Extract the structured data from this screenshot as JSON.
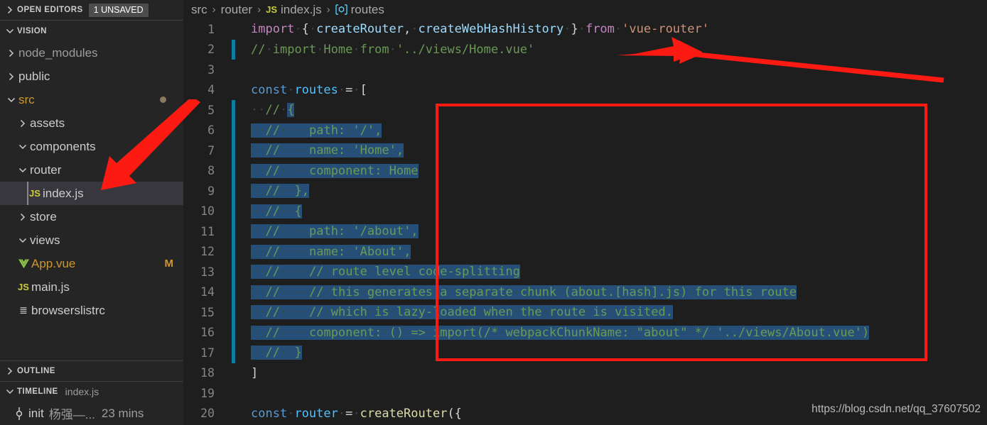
{
  "sidebar": {
    "open_editors": {
      "label": "OPEN EDITORS",
      "badge": "1 UNSAVED",
      "twisty": "chevron-right-icon"
    },
    "workspace": {
      "label": "VISION",
      "twisty": "chevron-down-icon"
    },
    "tree": [
      {
        "label": "node_modules",
        "icon": "chevron-right-icon",
        "depth": 1,
        "kind": "folder",
        "style": "dim"
      },
      {
        "label": "public",
        "icon": "chevron-right-icon",
        "depth": 1,
        "kind": "folder",
        "style": "normal"
      },
      {
        "label": "src",
        "icon": "chevron-down-icon",
        "depth": 1,
        "kind": "folder",
        "style": "orange",
        "dot": true
      },
      {
        "label": "assets",
        "icon": "chevron-right-icon",
        "depth": 2,
        "kind": "folder",
        "style": "normal"
      },
      {
        "label": "components",
        "icon": "chevron-down-icon",
        "depth": 2,
        "kind": "folder",
        "style": "normal"
      },
      {
        "label": "router",
        "icon": "chevron-down-icon",
        "depth": 2,
        "kind": "folder",
        "style": "normal"
      },
      {
        "label": "index.js",
        "icon": "js-file-icon",
        "depth": 3,
        "kind": "file",
        "style": "normal",
        "selected": true
      },
      {
        "label": "store",
        "icon": "chevron-right-icon",
        "depth": 2,
        "kind": "folder",
        "style": "normal"
      },
      {
        "label": "views",
        "icon": "chevron-down-icon",
        "depth": 2,
        "kind": "folder",
        "style": "normal"
      },
      {
        "label": "App.vue",
        "icon": "vue-file-icon",
        "depth": 2,
        "kind": "file",
        "style": "orange",
        "badge": "M"
      },
      {
        "label": "main.js",
        "icon": "js-file-icon",
        "depth": 2,
        "kind": "file",
        "style": "normal"
      },
      {
        "label": "browserslistrc",
        "icon": "config-file-icon",
        "depth": 2,
        "kind": "file",
        "style": "normal"
      }
    ],
    "outline": {
      "label": "OUTLINE",
      "twisty": "chevron-right-icon"
    },
    "timeline": {
      "label": "TIMELINE",
      "sub": "index.js",
      "twisty": "chevron-down-icon"
    },
    "timeline_items": [
      {
        "icon": "git-commit-icon",
        "label": "init",
        "author": "杨强—...",
        "time": "23 mins"
      }
    ]
  },
  "breadcrumb": {
    "items": [
      "src",
      "router",
      "index.js",
      "routes"
    ],
    "separator": "›",
    "file_icon": "JS",
    "symbol_icon": "symbol-variable-icon"
  },
  "colors": {
    "editor_bg": "#1e1e1e",
    "sidebar_bg": "#252526",
    "selection": "#264f78",
    "annotation_red": "#fd1a12",
    "gutter_modified": "#0c7d9d",
    "comment_green": "#6a9955"
  },
  "editor": {
    "lines": [
      {
        "n": "1",
        "modified": false,
        "tokens": [
          {
            "t": "import ",
            "c": "t-kw"
          },
          {
            "t": "{ ",
            "c": "t-plain"
          },
          {
            "t": "createRouter",
            "c": "t-id"
          },
          {
            "t": ", ",
            "c": "t-plain"
          },
          {
            "t": "createWebHashHistory",
            "c": "t-id"
          },
          {
            "t": " } ",
            "c": "t-plain"
          },
          {
            "t": "from",
            "c": "t-kw"
          },
          {
            "t": " ",
            "c": "t-plain"
          },
          {
            "t": "'vue-router'",
            "c": "t-str"
          }
        ]
      },
      {
        "n": "2",
        "modified": true,
        "tokens": [
          {
            "t": "// import Home from '../views/Home.vue'",
            "c": "t-com"
          }
        ]
      },
      {
        "n": "3",
        "modified": false,
        "tokens": []
      },
      {
        "n": "4",
        "modified": false,
        "tokens": [
          {
            "t": "const",
            "c": "t-kw2"
          },
          {
            "t": " ",
            "c": "t-plain"
          },
          {
            "t": "routes",
            "c": "t-var"
          },
          {
            "t": " = [",
            "c": "t-plain"
          }
        ]
      },
      {
        "n": "5",
        "modified": true,
        "tokens": [
          {
            "t": "  ",
            "c": "ws",
            "ws": true
          },
          {
            "t": "// ",
            "c": "t-com"
          },
          {
            "t": "{",
            "c": "t-com",
            "sel": true
          }
        ]
      },
      {
        "n": "6",
        "modified": true,
        "selected_all": true,
        "tokens": [
          {
            "t": "  //    path: '/',",
            "c": "t-com"
          }
        ]
      },
      {
        "n": "7",
        "modified": true,
        "selected_all": true,
        "tokens": [
          {
            "t": "  //    name: 'Home',",
            "c": "t-com"
          }
        ]
      },
      {
        "n": "8",
        "modified": true,
        "selected_all": true,
        "tokens": [
          {
            "t": "  //    component: Home",
            "c": "t-com"
          }
        ]
      },
      {
        "n": "9",
        "modified": true,
        "selected_all": true,
        "tokens": [
          {
            "t": "  //  },",
            "c": "t-com"
          }
        ]
      },
      {
        "n": "10",
        "modified": true,
        "selected_all": true,
        "tokens": [
          {
            "t": "  //  {",
            "c": "t-com"
          }
        ]
      },
      {
        "n": "11",
        "modified": true,
        "selected_all": true,
        "tokens": [
          {
            "t": "  //    path: '/about',",
            "c": "t-com"
          }
        ]
      },
      {
        "n": "12",
        "modified": true,
        "selected_all": true,
        "tokens": [
          {
            "t": "  //    name: 'About',",
            "c": "t-com"
          }
        ]
      },
      {
        "n": "13",
        "modified": true,
        "selected_all": true,
        "tokens": [
          {
            "t": "  //    // route level code-splitting",
            "c": "t-com"
          }
        ]
      },
      {
        "n": "14",
        "modified": true,
        "selected_all": true,
        "tokens": [
          {
            "t": "  //    // this generates a separate chunk (about.[hash].js) for this route",
            "c": "t-com"
          }
        ]
      },
      {
        "n": "15",
        "modified": true,
        "selected_all": true,
        "tokens": [
          {
            "t": "  //    // which is lazy-loaded when the route is visited.",
            "c": "t-com"
          }
        ]
      },
      {
        "n": "16",
        "modified": true,
        "selected_all": true,
        "tokens": [
          {
            "t": "  //    component: () => import(/* webpackChunkName: \"about\" */ '../views/About.vue')",
            "c": "t-com"
          }
        ]
      },
      {
        "n": "17",
        "modified": true,
        "selected_all": true,
        "tokens": [
          {
            "t": "  //  }",
            "c": "t-com"
          }
        ]
      },
      {
        "n": "18",
        "modified": false,
        "tokens": [
          {
            "t": "]",
            "c": "t-plain"
          }
        ]
      },
      {
        "n": "19",
        "modified": false,
        "tokens": []
      },
      {
        "n": "20",
        "modified": false,
        "tokens": [
          {
            "t": "const",
            "c": "t-kw2"
          },
          {
            "t": " ",
            "c": "t-plain"
          },
          {
            "t": "router",
            "c": "t-var"
          },
          {
            "t": " = ",
            "c": "t-plain"
          },
          {
            "t": "createRouter",
            "c": "t-fn"
          },
          {
            "t": "({",
            "c": "t-plain"
          }
        ]
      }
    ]
  },
  "annotations": {
    "red_box_label": "highlighted-commented-routes-block",
    "arrows": [
      {
        "name": "arrow-to-home-import",
        "target": "line 2 comment"
      },
      {
        "name": "arrow-to-index-js",
        "target": "sidebar index.js"
      }
    ]
  },
  "watermark": "https://blog.csdn.net/qq_37607502"
}
